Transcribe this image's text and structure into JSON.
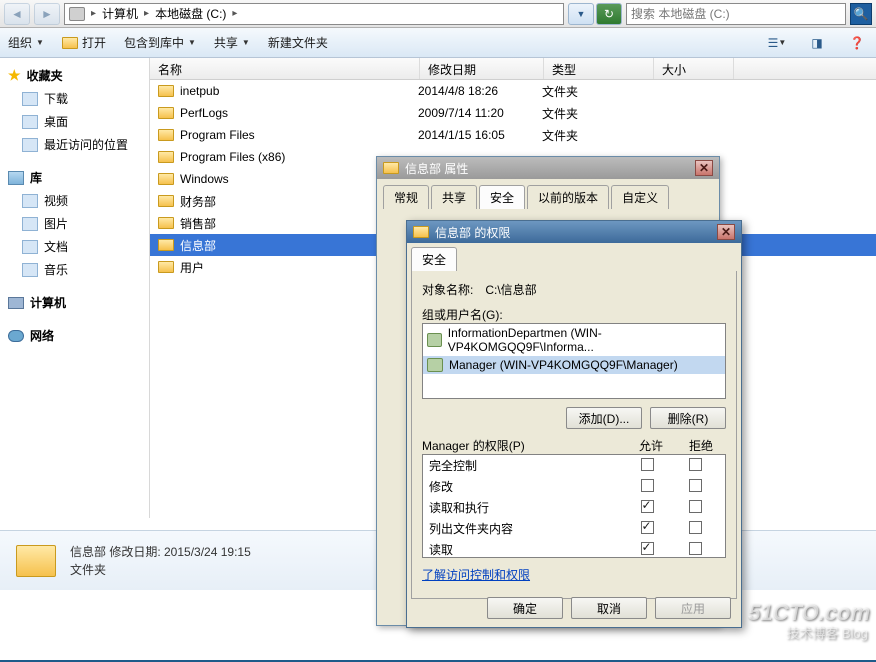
{
  "breadcrumb": {
    "seg1": "计算机",
    "seg2": "本地磁盘 (C:)"
  },
  "search": {
    "placeholder": "搜索 本地磁盘 (C:)"
  },
  "toolbar": {
    "organize": "组织",
    "open": "打开",
    "include_lib": "包含到库中",
    "share": "共享",
    "new_folder": "新建文件夹"
  },
  "sidebar": {
    "fav_head": "收藏夹",
    "fav": [
      "下载",
      "桌面",
      "最近访问的位置"
    ],
    "lib_head": "库",
    "lib": [
      "视频",
      "图片",
      "文档",
      "音乐"
    ],
    "computer": "计算机",
    "network": "网络"
  },
  "cols": {
    "name": "名称",
    "date": "修改日期",
    "type": "类型",
    "size": "大小"
  },
  "files": [
    {
      "name": "inetpub",
      "date": "2014/4/8 18:26",
      "type": "文件夹"
    },
    {
      "name": "PerfLogs",
      "date": "2009/7/14 11:20",
      "type": "文件夹"
    },
    {
      "name": "Program Files",
      "date": "2014/1/15 16:05",
      "type": "文件夹"
    },
    {
      "name": "Program Files (x86)",
      "date": "",
      "type": ""
    },
    {
      "name": "Windows",
      "date": "",
      "type": ""
    },
    {
      "name": "财务部",
      "date": "",
      "type": ""
    },
    {
      "name": "销售部",
      "date": "",
      "type": ""
    },
    {
      "name": "信息部",
      "date": "",
      "type": "",
      "selected": true
    },
    {
      "name": "用户",
      "date": "",
      "type": ""
    }
  ],
  "details": {
    "line1": "信息部  修改日期: 2015/3/24 19:15",
    "line2": "文件夹"
  },
  "dlg1": {
    "title": "信息部 属性",
    "tabs": [
      "常规",
      "共享",
      "安全",
      "以前的版本",
      "自定义"
    ]
  },
  "dlg2": {
    "title": "信息部 的权限",
    "tab": "安全",
    "obj_label": "对象名称:",
    "obj_value": "C:\\信息部",
    "group_label": "组或用户名(G):",
    "groups": [
      "InformationDepartmen (WIN-VP4KOMGQQ9F\\Informa...",
      "Manager (WIN-VP4KOMGQQ9F\\Manager)"
    ],
    "add_btn": "添加(D)...",
    "remove_btn": "删除(R)",
    "perm_label": "Manager 的权限(P)",
    "allow": "允许",
    "deny": "拒绝",
    "perms": [
      {
        "name": "完全控制",
        "allow": false,
        "deny": false
      },
      {
        "name": "修改",
        "allow": false,
        "deny": false
      },
      {
        "name": "读取和执行",
        "allow": true,
        "deny": false
      },
      {
        "name": "列出文件夹内容",
        "allow": true,
        "deny": false
      },
      {
        "name": "读取",
        "allow": true,
        "deny": false
      }
    ],
    "link": "了解访问控制和权限",
    "ok": "确定",
    "cancel": "取消",
    "apply": "应用"
  },
  "watermark": {
    "a": "51CTO.com",
    "b": "技术博客   Blog"
  }
}
